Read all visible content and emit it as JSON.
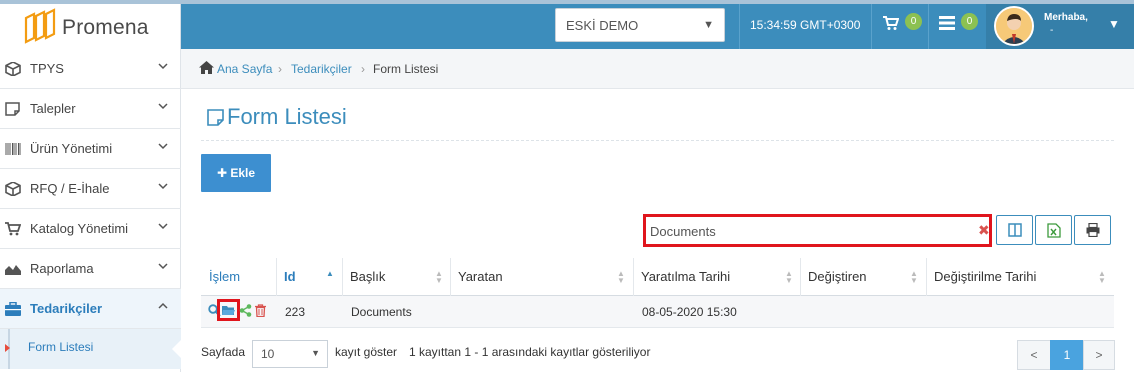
{
  "app": {
    "brand": "Promena"
  },
  "header": {
    "environment": "ESKİ DEMO",
    "clock": "15:34:59 GMT+0300",
    "cart_count": "0",
    "list_count": "0",
    "greeting": "Merhaba,",
    "user_name": "-",
    "accent_color": "#3c8dbc",
    "badge_color": "#8cc152"
  },
  "sidebar": {
    "items": [
      {
        "label": "TPYS",
        "icon": "cube-icon"
      },
      {
        "label": "Talepler",
        "icon": "note-icon"
      },
      {
        "label": "Ürün Yönetimi",
        "icon": "barcode-icon"
      },
      {
        "label": "RFQ / E-İhale",
        "icon": "cube-icon"
      },
      {
        "label": "Katalog Yönetimi",
        "icon": "cart-icon"
      },
      {
        "label": "Raporlama",
        "icon": "area-chart-icon"
      },
      {
        "label": "Tedarikçiler",
        "icon": "briefcase-icon"
      }
    ],
    "sub_item": "Form Listesi"
  },
  "breadcrumb": {
    "home": "Ana Sayfa",
    "suppliers": "Tedarikçiler",
    "current": "Form Listesi"
  },
  "page": {
    "title": "Form Listesi",
    "add_label": "Ekle"
  },
  "search": {
    "value": "Documents",
    "placeholder": "",
    "clear_icon": "x-icon"
  },
  "table": {
    "columns": [
      "İşlem",
      "Id",
      "Başlık",
      "Yaratan",
      "Yaratılma Tarihi",
      "Değiştiren",
      "Değiştirilme Tarihi"
    ],
    "rows": [
      {
        "id": "223",
        "title": "Documents",
        "creator": "",
        "created": "08-05-2020 15:30",
        "modifier": "",
        "modified": ""
      }
    ]
  },
  "footer": {
    "page_label": "Sayfada",
    "page_size": "10",
    "show_label": "kayıt göster",
    "summary": "1 kayıttan 1 - 1 arasındaki kayıtlar gösteriliyor",
    "prev": "<",
    "page": "1",
    "next": ">"
  }
}
